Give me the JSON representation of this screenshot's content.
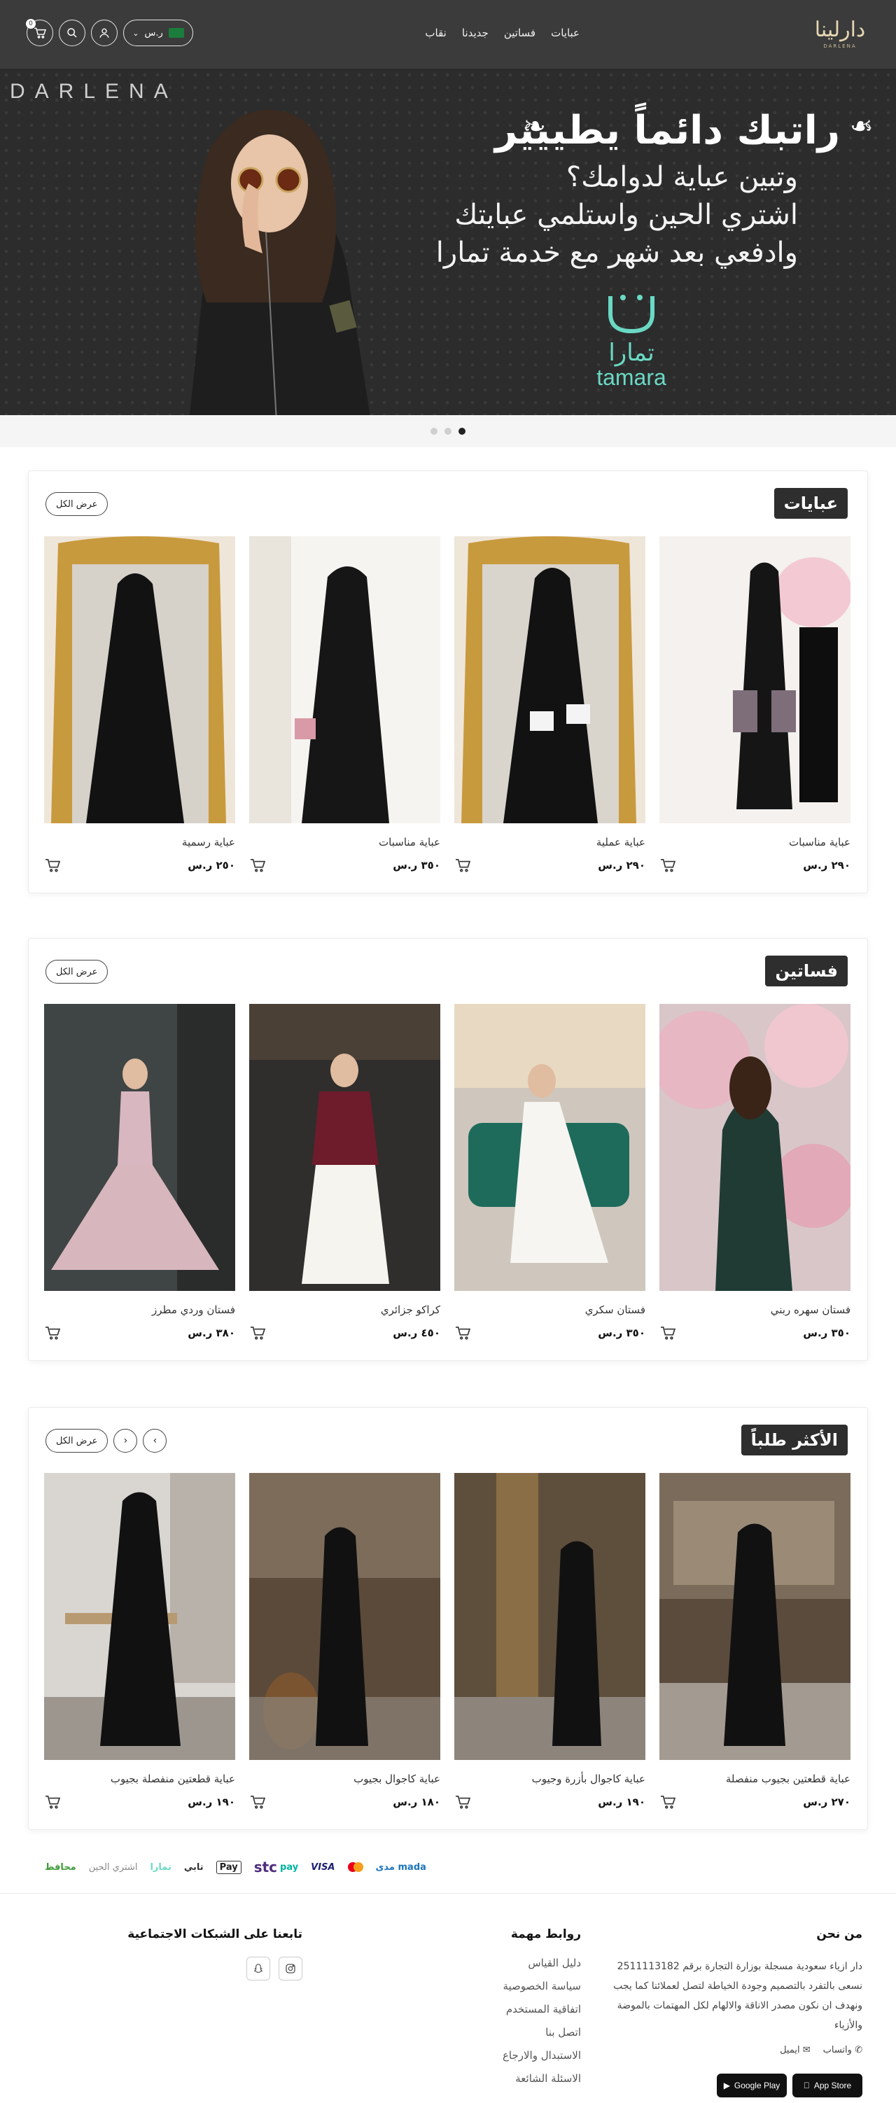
{
  "header": {
    "logo_text": "دارلينا",
    "logo_sub": "DARLENA",
    "nav": [
      "عبايات",
      "فساتين",
      "جديدنا",
      "نقاب"
    ],
    "currency": "ر.س",
    "cart_count": "0"
  },
  "hero": {
    "brand": "DARLENA",
    "title": "راتبك دائماً يطييير",
    "lines": [
      "وتبين عباية لدوامك؟",
      "اشتري الحين واستلمي عبايتك",
      "وادفعي بعد شهر مع خدمة تمارا"
    ],
    "partner_ar": "تمارا",
    "partner_en": "tamara",
    "dots": 3,
    "active_dot": 2
  },
  "sections": [
    {
      "title": "عبايات",
      "view_all": "عرض الكل",
      "products": [
        {
          "name": "عباية مناسبات",
          "price": "٢٩٠ ر.س"
        },
        {
          "name": "عباية عملية",
          "price": "٢٩٠ ر.س"
        },
        {
          "name": "عباية مناسبات",
          "price": "٣٥٠ ر.س"
        },
        {
          "name": "عباية رسمية",
          "price": "٢٥٠ ر.س"
        }
      ]
    },
    {
      "title": "فساتين",
      "view_all": "عرض الكل",
      "products": [
        {
          "name": "فستان سهره ربني",
          "price": "٣٥٠ ر.س"
        },
        {
          "name": "فستان سكري",
          "price": "٣٥٠ ر.س"
        },
        {
          "name": "كراكو جزائري",
          "price": "٤٥٠ ر.س"
        },
        {
          "name": "فستان وردي مطرز",
          "price": "٣٨٠ ر.س"
        }
      ]
    },
    {
      "title": "الأكثر طلباً",
      "view_all": "عرض الكل",
      "products": [
        {
          "name": "عباية قطعتين بجيوب منفصلة",
          "price": "٢٧٠ ر.س"
        },
        {
          "name": "عباية كاجوال بأزرة وجيوب",
          "price": "١٩٠ ر.س"
        },
        {
          "name": "عباية كاجوال بجيوب",
          "price": "١٨٠ ر.س"
        },
        {
          "name": "عباية قطعتين منفصلة بجيوب",
          "price": "١٩٠ ر.س"
        }
      ]
    }
  ],
  "payments": [
    "مدى mada",
    "VISA",
    "pay",
    "stc",
    "Pay",
    "تابي",
    "تمارا",
    "اشتري الحين",
    "محافظ"
  ],
  "footer": {
    "about_heading": "من نحن",
    "about_text": "دار ازياء سعودية مسجلة بوزارة التجارة برقم 2511113182 نسعى بالتفرد بالتصميم وجودة الخياطة لتصل لعملائنا كما يجب ونهدف ان نكون مصدر الاناقة والالهام لكل المهتمات بالموضة والأزياء",
    "whatsapp": "واتساب",
    "email": "ايميل",
    "links_heading": "روابط مهمة",
    "links": [
      "دليل القياس",
      "سياسة الخصوصية",
      "اتفاقية المستخدم",
      "اتصل بنا",
      "الاستبدال والارجاع",
      "الاسئلة الشائعة"
    ],
    "social_heading": "تابعنا على الشبكات الاجتماعية",
    "app_store": "App Store",
    "google_play": "Google Play"
  },
  "colors": {
    "header_bg": "#3b3b3b",
    "hero_bg": "#2c2c2c",
    "tamara": "#6ad9c4",
    "title_badge": "#2e2e2e"
  }
}
